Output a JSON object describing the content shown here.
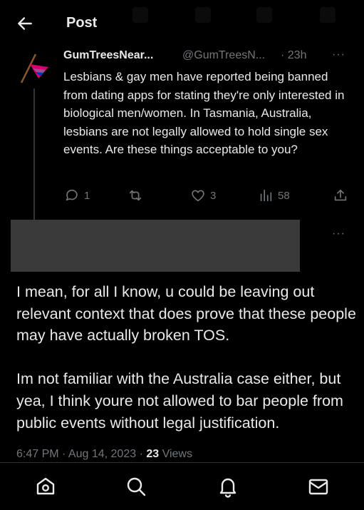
{
  "header": {
    "title": "Post"
  },
  "tweet": {
    "author": "GumTreesNear...",
    "handle": "@GumTreesN...",
    "time": "· 23h",
    "text": "Lesbians & gay men have reported being banned from dating apps for stating they're only interested in biological men/women. In Tasmania, Australia, lesbians are not legally allowed to hold single sex events. Are these things acceptable to you?",
    "actions": {
      "replies": "1",
      "retweets": "",
      "likes": "3",
      "views": "58"
    }
  },
  "reply": {
    "paragraphs": [
      "I mean, for all I know, u could be leaving out relevant context that does prove that these people may have actually broken TOS.",
      "Im not familiar with the Australia case either, but yea, I think youre not allowed to bar people from public events without legal justification."
    ],
    "timestamp": "6:47 PM · Aug 14, 2023 · ",
    "views_count": "23",
    "views_label": " Views"
  },
  "more_label": "···",
  "colors": {
    "background": "#000000",
    "text": "#e7e9ea",
    "muted": "#71767b",
    "redaction": "#3a3a3a"
  },
  "icons": [
    "back-arrow-icon",
    "reply-icon",
    "retweet-icon",
    "like-icon",
    "views-icon",
    "share-icon",
    "home-icon",
    "search-icon",
    "notifications-icon",
    "messages-icon"
  ]
}
